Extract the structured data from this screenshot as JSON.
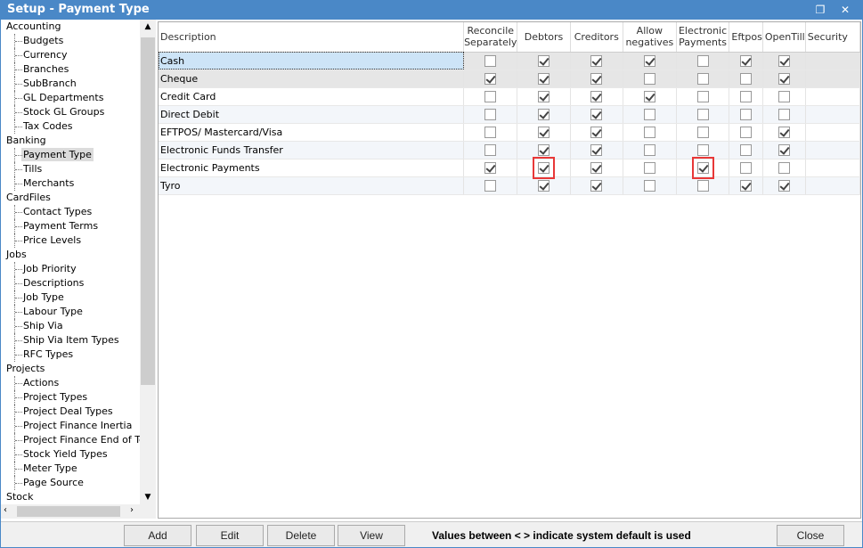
{
  "window": {
    "title": "Setup - Payment Type",
    "restore_icon": "restore-icon",
    "close_icon": "close-icon"
  },
  "sidebar": [
    {
      "label": "Accounting",
      "items": [
        "Budgets",
        "Currency",
        "Branches",
        "SubBranch",
        "GL Departments",
        "Stock GL Groups",
        "Tax Codes"
      ]
    },
    {
      "label": "Banking",
      "items": [
        "Payment Type",
        "Tills",
        "Merchants"
      ]
    },
    {
      "label": "CardFiles",
      "items": [
        "Contact Types",
        "Payment Terms",
        "Price Levels"
      ]
    },
    {
      "label": "Jobs",
      "items": [
        "Job Priority",
        "Descriptions",
        "Job Type",
        "Labour Type",
        "Ship Via",
        "Ship Via Item Types",
        "RFC Types"
      ]
    },
    {
      "label": "Projects",
      "items": [
        "Actions",
        "Project Types",
        "Project Deal Types",
        "Project Finance Inertia",
        "Project Finance End of Term",
        "Stock Yield Types",
        "Meter Type",
        "Page Source"
      ]
    },
    {
      "label": "Stock",
      "items": []
    }
  ],
  "selected_sidebar_item": "Payment Type",
  "table": {
    "columns": [
      "Description",
      "Reconcile Separately",
      "Debtors",
      "Creditors",
      "Allow negatives",
      "Electronic Payments",
      "Eftpos",
      "OpenTill",
      "Security"
    ],
    "rows": [
      {
        "description": "Cash",
        "values": [
          false,
          true,
          true,
          true,
          false,
          true,
          true
        ]
      },
      {
        "description": "Cheque",
        "values": [
          true,
          true,
          true,
          false,
          false,
          false,
          true
        ]
      },
      {
        "description": "Credit Card",
        "values": [
          false,
          true,
          true,
          true,
          false,
          false,
          false
        ]
      },
      {
        "description": "Direct Debit",
        "values": [
          false,
          true,
          true,
          false,
          false,
          false,
          false
        ]
      },
      {
        "description": "EFTPOS/ Mastercard/Visa",
        "values": [
          false,
          true,
          true,
          false,
          false,
          false,
          true
        ]
      },
      {
        "description": "Electronic Funds Transfer",
        "values": [
          false,
          true,
          true,
          false,
          false,
          false,
          true
        ]
      },
      {
        "description": "Electronic Payments",
        "values": [
          true,
          true,
          true,
          false,
          true,
          false,
          false
        ]
      },
      {
        "description": "Tyro",
        "values": [
          false,
          true,
          true,
          false,
          false,
          true,
          true
        ]
      }
    ],
    "selected_row": "Cash",
    "highlighted_cells": [
      {
        "row": "Electronic Payments",
        "column": "Debtors"
      },
      {
        "row": "Electronic Payments",
        "column": "Electronic Payments"
      }
    ],
    "highlight_color": "#e83838"
  },
  "footer": {
    "add": "Add",
    "edit": "Edit",
    "delete": "Delete",
    "view": "View",
    "note": "Values between < > indicate system default is used",
    "close": "Close"
  }
}
